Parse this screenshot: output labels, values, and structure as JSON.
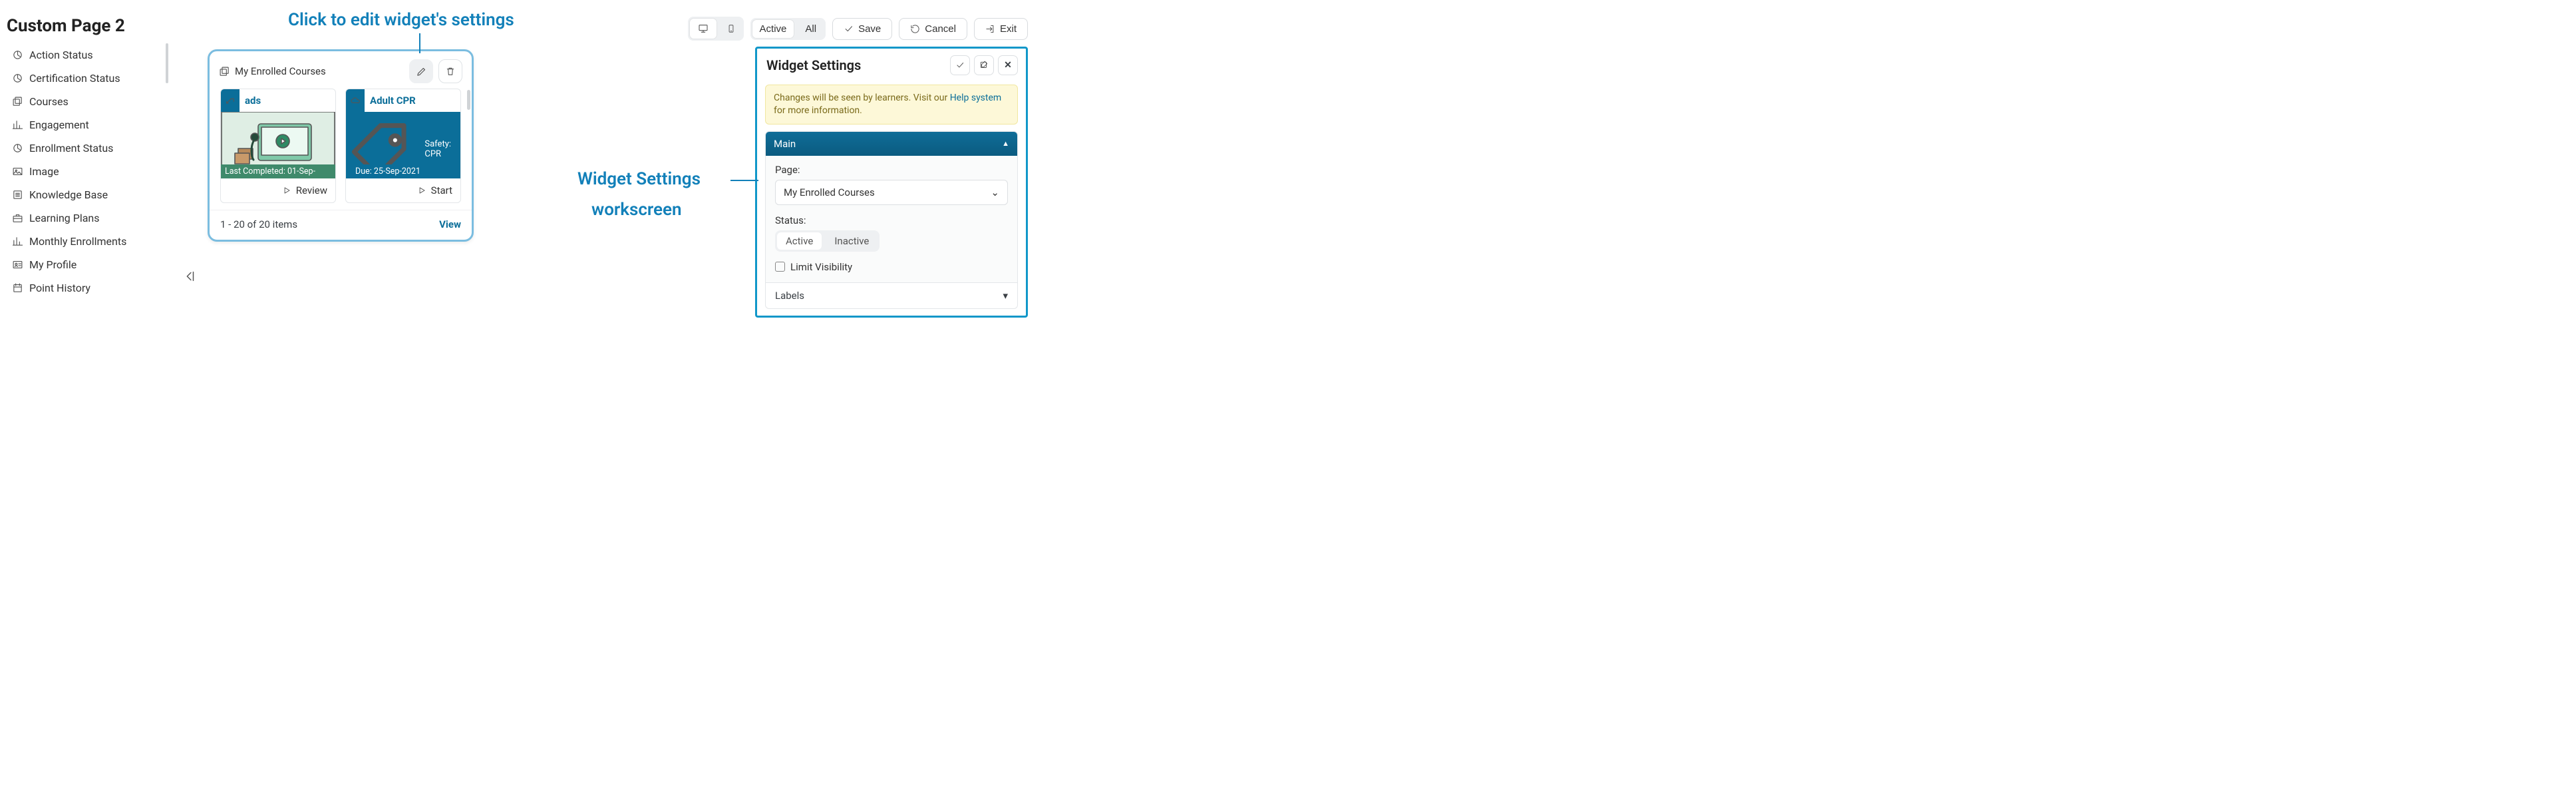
{
  "page_title": "Custom Page 2",
  "sidebar": {
    "items": [
      {
        "label": "Action Status",
        "icon": "pie"
      },
      {
        "label": "Certification Status",
        "icon": "pie"
      },
      {
        "label": "Courses",
        "icon": "copy"
      },
      {
        "label": "Engagement",
        "icon": "bars"
      },
      {
        "label": "Enrollment Status",
        "icon": "pie"
      },
      {
        "label": "Image",
        "icon": "image"
      },
      {
        "label": "Knowledge Base",
        "icon": "list"
      },
      {
        "label": "Learning Plans",
        "icon": "briefcase"
      },
      {
        "label": "Monthly Enrollments",
        "icon": "bars"
      },
      {
        "label": "My Profile",
        "icon": "idcard"
      },
      {
        "label": "Point History",
        "icon": "calendar"
      }
    ]
  },
  "toolbar": {
    "active": "Active",
    "all": "All",
    "save": "Save",
    "cancel": "Cancel",
    "exit": "Exit"
  },
  "widget": {
    "title": "My Enrolled Courses",
    "cards": [
      {
        "title": "ads",
        "badge": "Last Completed: 01-Sep-",
        "action": "Review"
      },
      {
        "title": "Adult CPR",
        "tag": "Safety: CPR",
        "badge": "Due: 25-Sep-2021",
        "action": "Start"
      }
    ],
    "footer_count": "1 - 20 of 20 items",
    "footer_view": "View"
  },
  "panel": {
    "title": "Widget Settings",
    "alert_pre": "Changes will be seen by learners. Visit our ",
    "alert_link": "Help system",
    "alert_post": " for more information.",
    "sections": {
      "main": "Main",
      "labels": "Labels"
    },
    "page_label": "Page:",
    "page_value": "My Enrolled Courses",
    "status_label": "Status:",
    "status_active": "Active",
    "status_inactive": "Inactive",
    "limit": "Limit Visibility"
  },
  "annotations": {
    "a1": "Click to edit widget's settings",
    "a2": "Widget Settings",
    "a3": "workscreen"
  }
}
